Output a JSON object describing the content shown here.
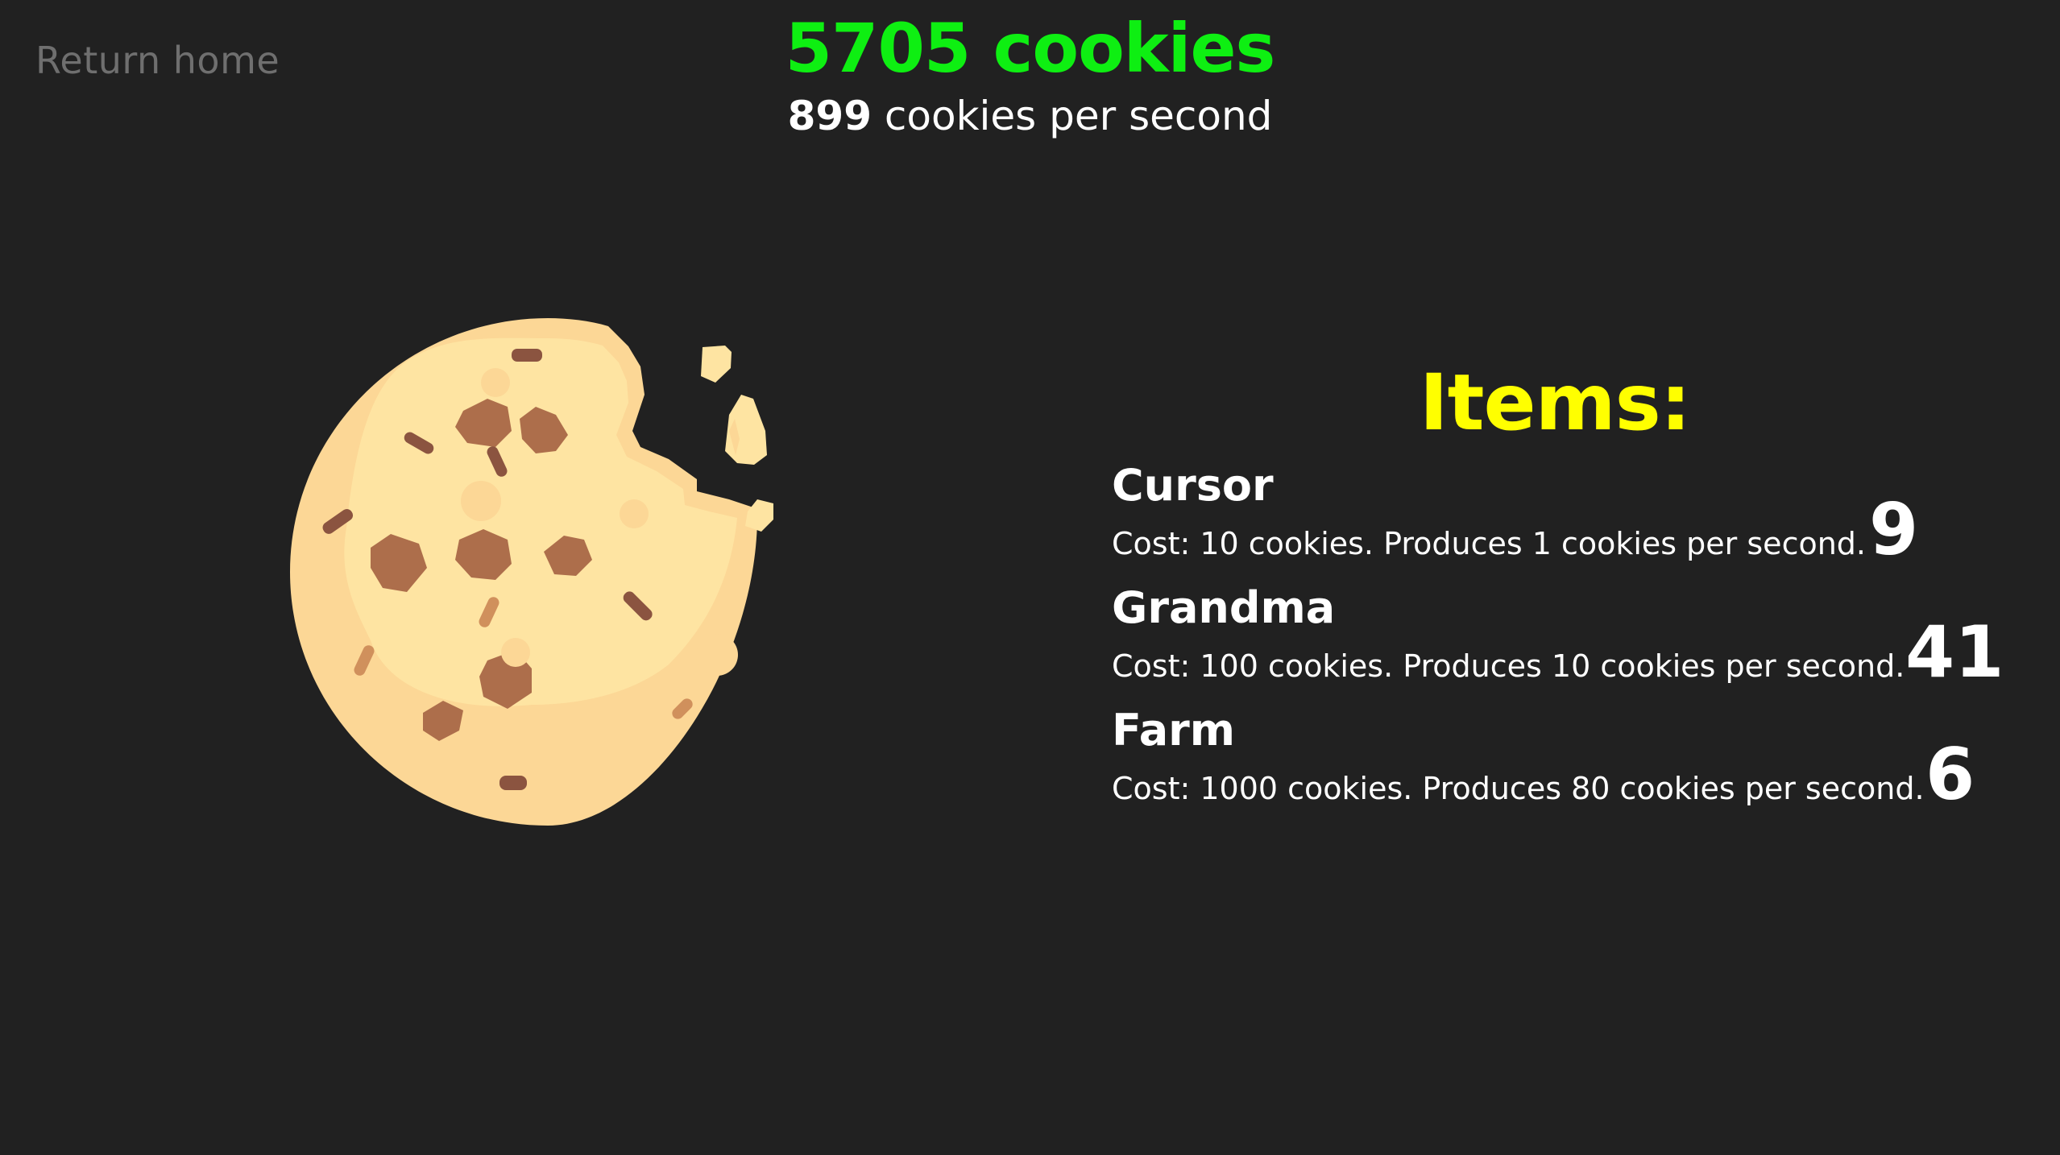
{
  "nav": {
    "home_label": "Return home"
  },
  "stats": {
    "cookies_count": "5705",
    "cookies_unit": "cookies",
    "per_second_value": "899",
    "per_second_label": "cookies per second"
  },
  "colors": {
    "background": "#212121",
    "count_color": "#0eef12",
    "items_title_color": "#ffff00",
    "home_link_color": "#6f6f6f"
  },
  "cookie": {
    "icon": "cookie-icon"
  },
  "items": {
    "title": "Items:",
    "list": [
      {
        "name": "Cursor",
        "description": "Cost: 10 cookies. Produces 1 cookies per second.",
        "owned": "9"
      },
      {
        "name": "Grandma",
        "description": "Cost: 100 cookies. Produces 10 cookies per second.",
        "owned": "41"
      },
      {
        "name": "Farm",
        "description": "Cost: 1000 cookies. Produces 80 cookies per second.",
        "owned": "6"
      }
    ]
  }
}
